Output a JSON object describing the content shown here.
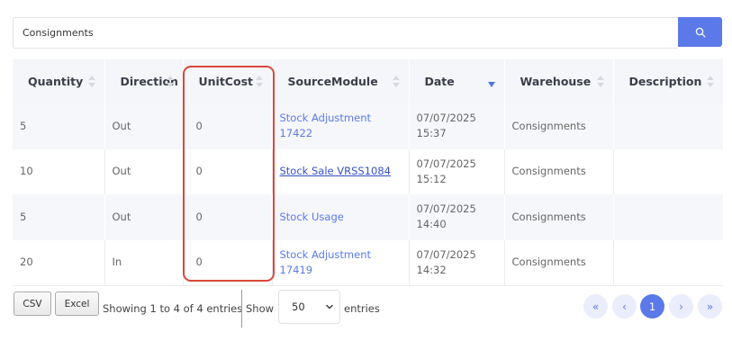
{
  "search": {
    "value": "Consignments",
    "button_icon": "search-icon"
  },
  "table": {
    "columns": [
      "Quantity",
      "Direction",
      "UnitCost",
      "SourceModule",
      "Date",
      "Warehouse",
      "Description"
    ],
    "sort": {
      "column": "Date",
      "direction": "descending"
    },
    "rows": [
      {
        "quantity": "5",
        "direction": "Out",
        "unit_cost": "0",
        "source": "Stock Adjustment 17422",
        "date": "07/07/2025 15:37",
        "warehouse": "Consignments",
        "description": ""
      },
      {
        "quantity": "10",
        "direction": "Out",
        "unit_cost": "0",
        "source": "Stock Sale VRSS1084",
        "date": "07/07/2025 15:12",
        "warehouse": "Consignments",
        "description": ""
      },
      {
        "quantity": "5",
        "direction": "Out",
        "unit_cost": "0",
        "source": "Stock Usage",
        "date": "07/07/2025 14:40",
        "warehouse": "Consignments",
        "description": ""
      },
      {
        "quantity": "20",
        "direction": "In",
        "unit_cost": "0",
        "source": "Stock Adjustment 17419",
        "date": "07/07/2025 14:32",
        "warehouse": "Consignments",
        "description": ""
      }
    ]
  },
  "footer": {
    "csv_label": "CSV",
    "excel_label": "Excel",
    "info": "Showing 1 to 4 of 4 entries",
    "show_label": "Show",
    "page_size": "50",
    "entries_label": "entries"
  },
  "pagination": {
    "first": "«",
    "prev": "‹",
    "current": "1",
    "next": "›",
    "last": "»"
  },
  "colors": {
    "accent": "#5b79e8",
    "highlight": "#d9483b"
  }
}
